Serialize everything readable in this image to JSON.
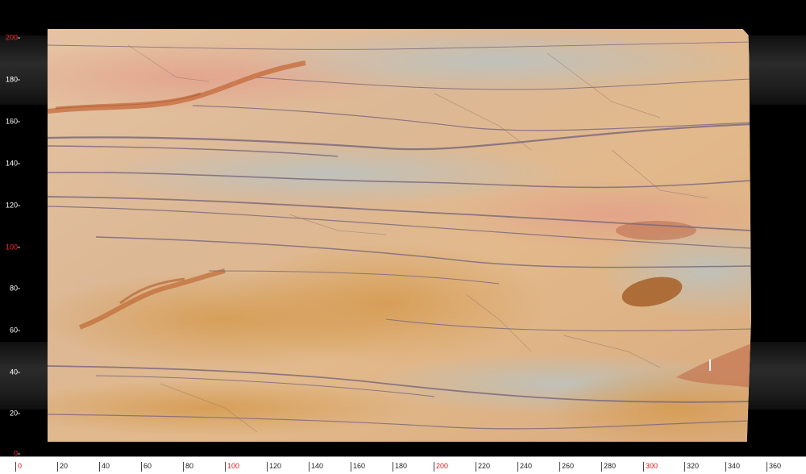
{
  "image": {
    "subject": "stone-slab",
    "colors": {
      "base": "#e0b88e",
      "veins_purple": "#7d6a7e",
      "veins_rust": "#c46a3a",
      "background": "#000000",
      "ruler_label": "#ffffff",
      "ruler_label_red": "#ff2b2b",
      "bottom_ruler_bg": "#ffffff"
    }
  },
  "vertical_ruler": {
    "labels": [
      {
        "text": "200",
        "highlight": true
      },
      {
        "text": "180",
        "highlight": false
      },
      {
        "text": "160",
        "highlight": false
      },
      {
        "text": "140",
        "highlight": false
      },
      {
        "text": "120",
        "highlight": false
      },
      {
        "text": "100",
        "highlight": true
      },
      {
        "text": "80",
        "highlight": false
      },
      {
        "text": "60",
        "highlight": false
      },
      {
        "text": "40",
        "highlight": false
      },
      {
        "text": "20",
        "highlight": false
      },
      {
        "text": "0",
        "highlight": true
      }
    ]
  },
  "horizontal_ruler": {
    "labels": [
      {
        "text": "0",
        "highlight": true
      },
      {
        "text": "20",
        "highlight": false
      },
      {
        "text": "40",
        "highlight": false
      },
      {
        "text": "60",
        "highlight": false
      },
      {
        "text": "80",
        "highlight": false
      },
      {
        "text": "100",
        "highlight": true
      },
      {
        "text": "120",
        "highlight": false
      },
      {
        "text": "140",
        "highlight": false
      },
      {
        "text": "160",
        "highlight": false
      },
      {
        "text": "180",
        "highlight": false
      },
      {
        "text": "200",
        "highlight": true
      },
      {
        "text": "220",
        "highlight": false
      },
      {
        "text": "240",
        "highlight": false
      },
      {
        "text": "260",
        "highlight": false
      },
      {
        "text": "280",
        "highlight": false
      },
      {
        "text": "300",
        "highlight": true
      },
      {
        "text": "320",
        "highlight": false
      },
      {
        "text": "340",
        "highlight": false
      },
      {
        "text": "360",
        "highlight": false
      }
    ]
  }
}
